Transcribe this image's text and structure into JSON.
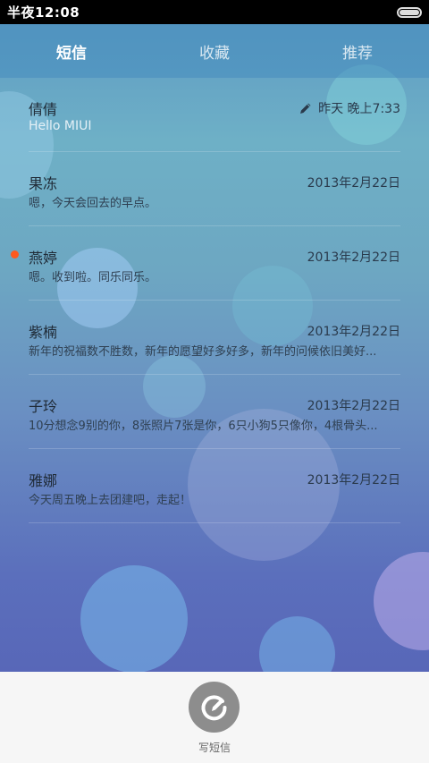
{
  "status_bar": {
    "time": "半夜12:08"
  },
  "tabs": [
    {
      "label": "短信",
      "active": true
    },
    {
      "label": "收藏",
      "active": false
    },
    {
      "label": "推荐",
      "active": false
    }
  ],
  "conversations": [
    {
      "name": "倩倩",
      "date": "昨天 晚上7:33",
      "preview": "Hello MIUI",
      "unread": false,
      "draft": true
    },
    {
      "name": "果冻",
      "date": "2013年2月22日",
      "preview": "嗯，今天会回去的早点。",
      "unread": false,
      "draft": false
    },
    {
      "name": "燕婷",
      "date": "2013年2月22日",
      "preview": "嗯。收到啦。同乐同乐。",
      "unread": true,
      "draft": false
    },
    {
      "name": "紫楠",
      "date": "2013年2月22日",
      "preview": "新年的祝福数不胜数，新年的愿望好多好多，新年的问候依旧美好...",
      "unread": false,
      "draft": false
    },
    {
      "name": "子玲",
      "date": "2013年2月22日",
      "preview": "10分想念9别的你，8张照片7张是你，6只小狗5只像你，4根骨头...",
      "unread": false,
      "draft": false
    },
    {
      "name": "雅娜",
      "date": "2013年2月22日",
      "preview": "今天周五晚上去团建吧，走起！",
      "unread": false,
      "draft": false
    }
  ],
  "compose": {
    "label": "写短信"
  },
  "colors": {
    "unread_dot": "#ff5a1f",
    "compose_button": "#8d8d8d"
  }
}
